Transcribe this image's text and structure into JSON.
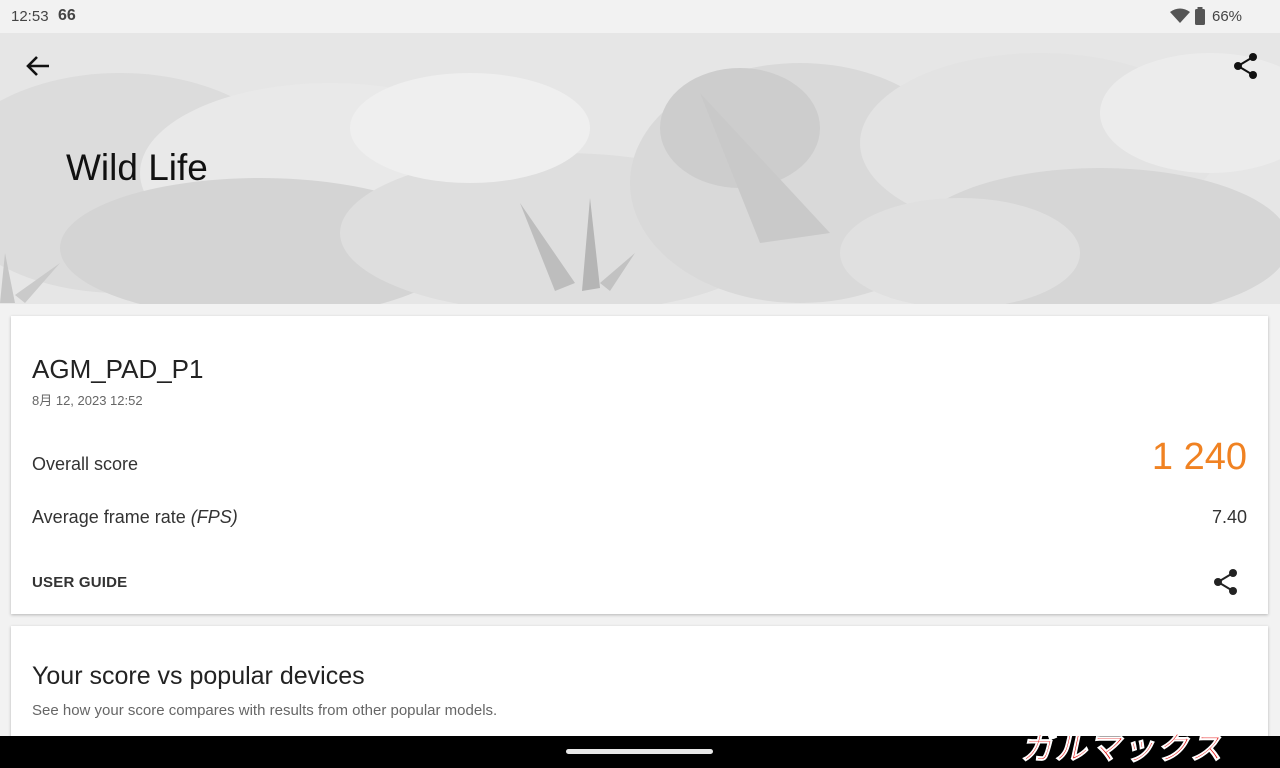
{
  "status_bar": {
    "time": "12:53",
    "notification": "66",
    "battery_text": "66%"
  },
  "header": {
    "title": "Wild Life",
    "back_icon": "arrow-left-icon",
    "share_icon": "share-icon"
  },
  "result": {
    "device_name": "AGM_PAD_P1",
    "date": "8月 12, 2023 12:52",
    "overall_label": "Overall score",
    "overall_value": "1 240",
    "fps_label": "Average frame rate ",
    "fps_unit": "(FPS)",
    "fps_value": "7.40",
    "user_guide": "USER GUIDE"
  },
  "compare": {
    "title": "Your score vs popular devices",
    "subtitle": "See how your score compares with results from other popular models."
  },
  "watermark": "ガルマックス",
  "colors": {
    "accent": "#f08222",
    "watermark_red": "#e30000"
  }
}
